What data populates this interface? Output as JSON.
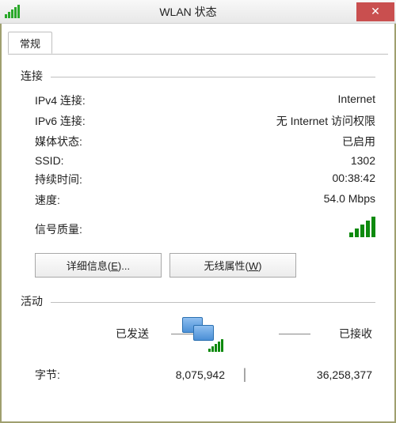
{
  "window": {
    "title": "WLAN 状态"
  },
  "tab": {
    "general": "常规"
  },
  "sections": {
    "connection": "连接",
    "activity": "活动"
  },
  "conn": {
    "ipv4_label": "IPv4 连接:",
    "ipv4_value": "Internet",
    "ipv6_label": "IPv6 连接:",
    "ipv6_value": "无 Internet 访问权限",
    "media_label": "媒体状态:",
    "media_value": "已启用",
    "ssid_label": "SSID:",
    "ssid_value": "1302",
    "duration_label": "持续时间:",
    "duration_value": "00:38:42",
    "speed_label": "速度:",
    "speed_value": "54.0 Mbps",
    "signal_label": "信号质量:"
  },
  "buttons": {
    "details_prefix": "详细信息(",
    "details_key": "E",
    "details_suffix": ")...",
    "wireless_prefix": "无线属性(",
    "wireless_key": "W",
    "wireless_suffix": ")"
  },
  "activity": {
    "sent": "已发送",
    "received": "已接收",
    "bytes_label": "字节:",
    "bytes_sent": "8,075,942",
    "bytes_recv": "36,258,377"
  }
}
